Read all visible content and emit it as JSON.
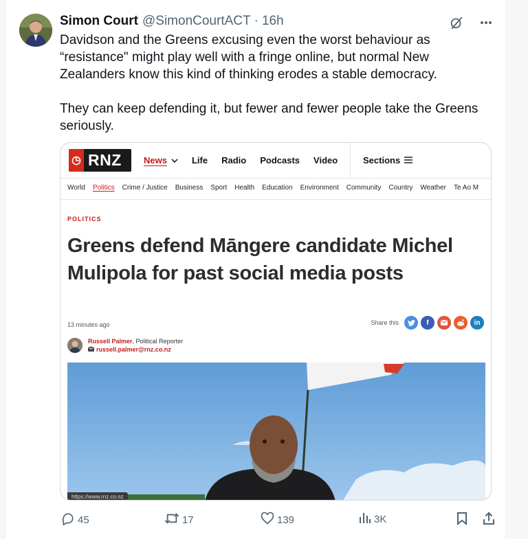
{
  "tweet": {
    "author_name": "Simon Court",
    "handle": "@SimonCourtACT",
    "separator": "·",
    "time": "16h",
    "paragraphs": [
      "Davidson and the Greens excusing even the worst behaviour as\n“resistance\" might play well with a fringe online, but normal New\nZealanders know this kind of thinking erodes  a stable democracy.",
      "They can keep defending it, but fewer and fewer people take the Greens\nseriously."
    ],
    "header_icons": [
      "grok-icon",
      "more-icon"
    ]
  },
  "card": {
    "logo_text": "RNZ",
    "main_nav": [
      {
        "label": "News",
        "active": true,
        "chevron": true
      },
      {
        "label": "Life"
      },
      {
        "label": "Radio"
      },
      {
        "label": "Podcasts"
      },
      {
        "label": "Video"
      }
    ],
    "sections_label": "Sections",
    "sub_nav": [
      "World",
      "Politics",
      "Crime / Justice",
      "Business",
      "Sport",
      "Health",
      "Education",
      "Environment",
      "Community",
      "Country",
      "Weather",
      "Te Ao M"
    ],
    "sub_nav_active": "Politics",
    "kicker": "POLITICS",
    "headline": "Greens defend Māngere candidate Michel Mulipola for past social media posts",
    "published": "13 minutes ago",
    "share_label": "Share this",
    "share_buttons": [
      {
        "name": "twitter",
        "color": "#4a90e2"
      },
      {
        "name": "facebook",
        "color": "#3b5bb5"
      },
      {
        "name": "email",
        "color": "#e0553f"
      },
      {
        "name": "reddit",
        "color": "#e8612c"
      },
      {
        "name": "linkedin",
        "color": "#1f7fbf"
      }
    ],
    "author": "Russell Palmer",
    "author_role": ", Political Reporter",
    "author_email": "russell.palmer@rnz.co.nz",
    "url_tooltip": "https://www.rnz.co.nz"
  },
  "actions": {
    "replies": "45",
    "reposts": "17",
    "likes": "139",
    "views": "3K"
  },
  "colors": {
    "rnz_red": "#c41a1a",
    "twitter_grey": "#536471"
  }
}
